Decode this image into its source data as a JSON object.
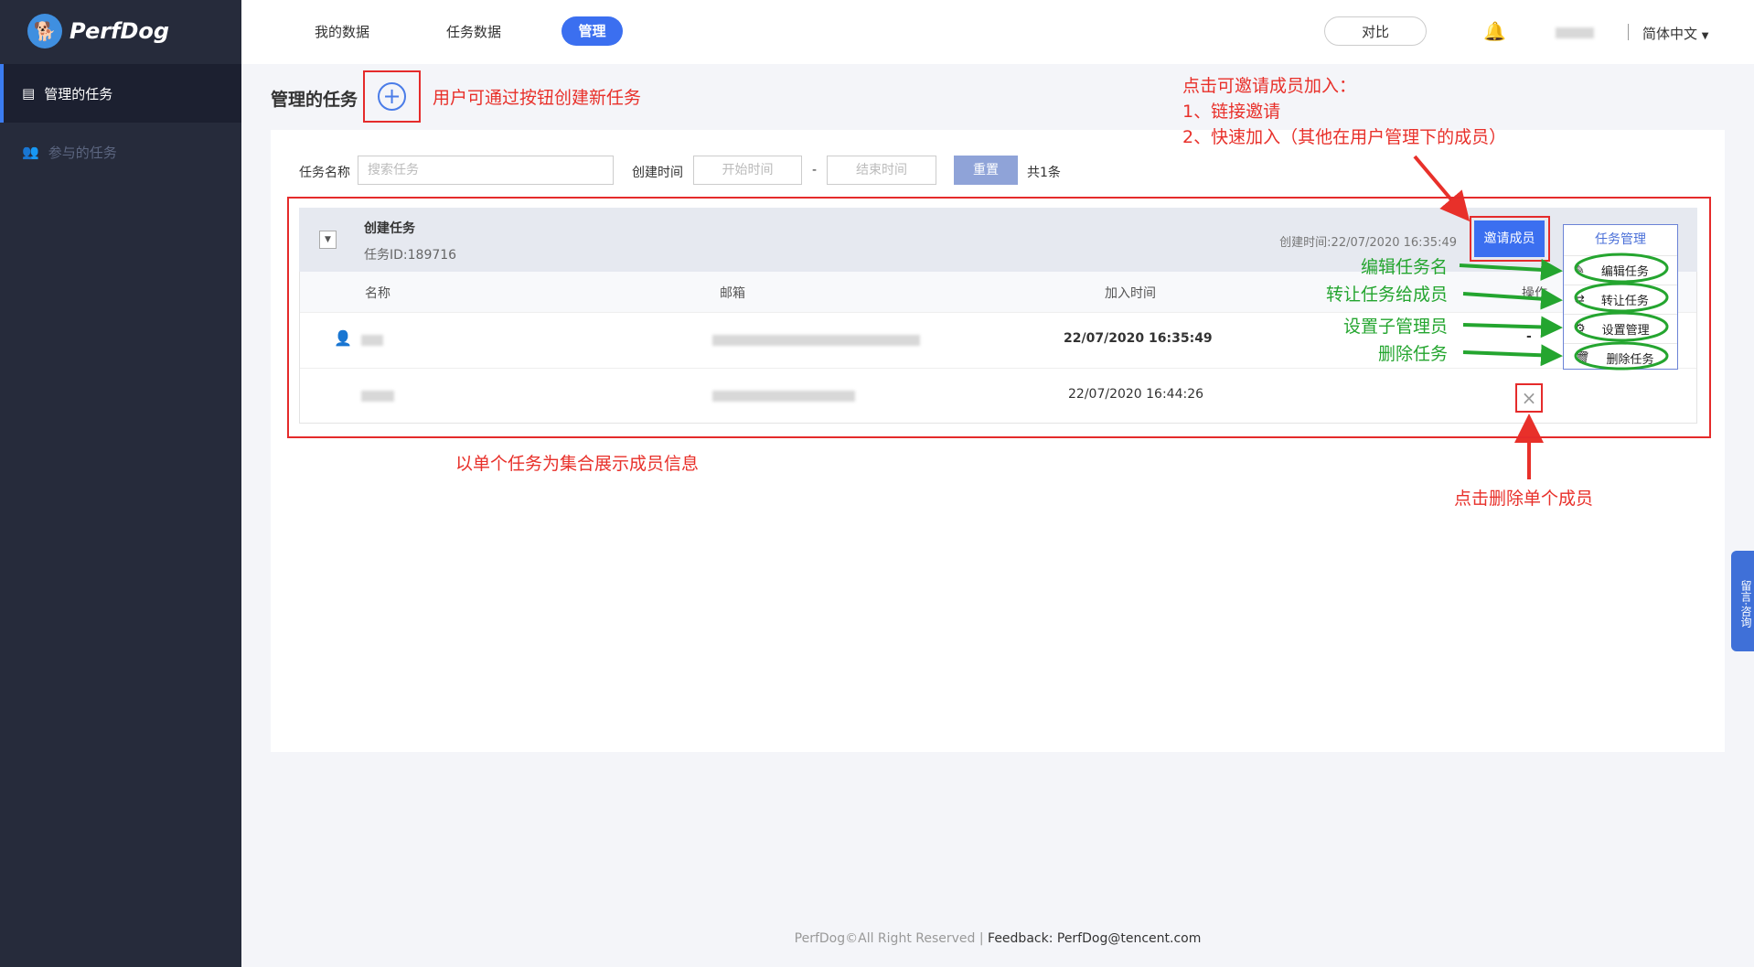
{
  "app": {
    "name": "PerfDog"
  },
  "sidebar": {
    "items": [
      {
        "label": "管理的任务",
        "icon": "task-list-icon"
      },
      {
        "label": "参与的任务",
        "icon": "users-icon"
      }
    ]
  },
  "topbar": {
    "nav": [
      "我的数据",
      "任务数据",
      "管理"
    ],
    "compare": "对比",
    "language": "简体中文"
  },
  "page": {
    "title": "管理的任务"
  },
  "filter": {
    "name_label": "任务名称",
    "name_placeholder": "搜索任务",
    "time_label": "创建时间",
    "start_placeholder": "开始时间",
    "dash": "-",
    "end_placeholder": "结束时间",
    "reset": "重置",
    "count": "共1条"
  },
  "task": {
    "name": "创建任务",
    "id": "任务ID:189716",
    "created": "创建时间:22/07/2020 16:35:49",
    "invite": "邀请成员",
    "manage": "任务管理",
    "menu": [
      "编辑任务",
      "转让任务",
      "设置管理",
      "删除任务"
    ],
    "columns": [
      "名称",
      "邮箱",
      "加入时间",
      "操作"
    ],
    "rows": [
      {
        "time": "22/07/2020 16:35:49",
        "action": "-"
      },
      {
        "time": "22/07/2020 16:44:26",
        "action": "×"
      }
    ]
  },
  "annotations": {
    "create": "用户可通过按钮创建新任务",
    "invite": [
      "点击可邀请成员加入：",
      "1、链接邀请",
      "2、快速加入（其他在用户管理下的成员）"
    ],
    "group": "以单个任务为集合展示成员信息",
    "delete_member": "点击删除单个成员",
    "menu": [
      "编辑任务名",
      "转让任务给成员",
      "设置子管理员",
      "删除任务"
    ]
  },
  "footer": {
    "copyright": "PerfDog©All Right Reserved | ",
    "feedback": "Feedback: PerfDog@tencent.com"
  },
  "float_tab": "留言·咨询",
  "colors": {
    "accent": "#3b6ff0",
    "annotation_red": "#e8302a",
    "annotation_green": "#24a52f"
  }
}
